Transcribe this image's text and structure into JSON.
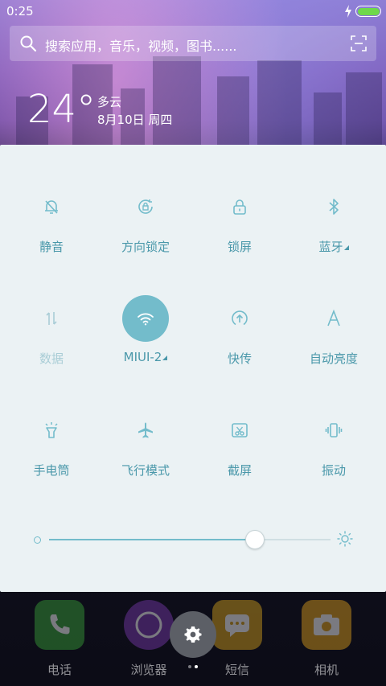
{
  "status_bar": {
    "time": "0:25",
    "battery_level": 1.0,
    "charging": true
  },
  "search": {
    "placeholder": "搜索应用，音乐，视频，图书......"
  },
  "weather": {
    "temperature": "24°",
    "condition": "多云",
    "date": "8月10日 周四"
  },
  "toggles": [
    {
      "label": "静音",
      "icon": "bell-off-icon",
      "active": false
    },
    {
      "label": "方向锁定",
      "icon": "rotation-lock-icon",
      "active": false
    },
    {
      "label": "锁屏",
      "icon": "lock-icon",
      "active": false
    },
    {
      "label": "蓝牙",
      "icon": "bluetooth-icon",
      "active": false,
      "has_menu": true
    },
    {
      "label": "数据",
      "icon": "mobile-data-icon",
      "active": false,
      "disabled": true
    },
    {
      "label": "MIUI-2",
      "icon": "wifi-icon",
      "active": true,
      "has_menu": true
    },
    {
      "label": "快传",
      "icon": "quick-share-icon",
      "active": false
    },
    {
      "label": "自动亮度",
      "icon": "auto-brightness-icon",
      "active": false
    },
    {
      "label": "手电筒",
      "icon": "flashlight-icon",
      "active": false
    },
    {
      "label": "飞行模式",
      "icon": "airplane-icon",
      "active": false
    },
    {
      "label": "截屏",
      "icon": "screenshot-icon",
      "active": false
    },
    {
      "label": "振动",
      "icon": "vibrate-icon",
      "active": false
    }
  ],
  "brightness": {
    "level": 0.73
  },
  "dock": [
    {
      "label": "电话",
      "icon": "phone-icon",
      "color": "#3aa53a"
    },
    {
      "label": "浏览器",
      "icon": "browser-icon",
      "color": "#7a3ab0"
    },
    {
      "label": "短信",
      "icon": "message-icon",
      "color": "#d7a31c"
    },
    {
      "label": "相机",
      "icon": "camera-icon",
      "color": "#e2a21c"
    }
  ],
  "colors": {
    "accent": "#73bccb",
    "label": "#4a98aa",
    "panel_bg": "#ebf2f4"
  }
}
